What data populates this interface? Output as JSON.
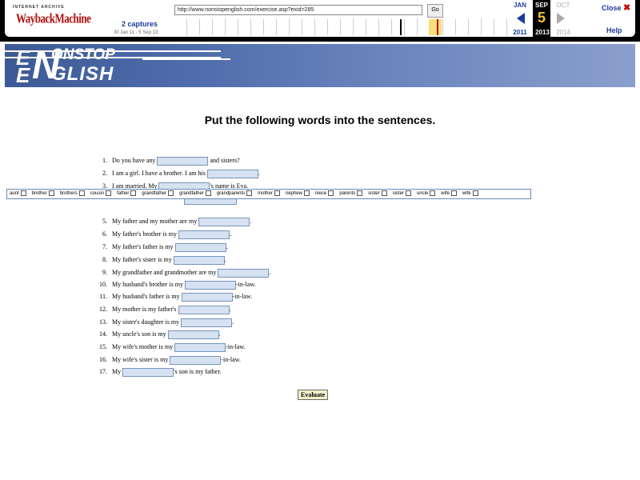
{
  "wayback": {
    "ia_label": "INTERNET ARCHIVE",
    "logo": "WaybackMachine",
    "url": "http://www.nonstopenglish.com/exercise.asp?exid=285",
    "go": "Go",
    "captures": "2 captures",
    "range": "30 Jan 11 - 5 Sep 13",
    "months": {
      "prev": "JAN",
      "current": "SEP",
      "next": "OCT"
    },
    "day": "5",
    "years": {
      "prev": "2011",
      "current": "2013",
      "next": "2014"
    },
    "close": "Close",
    "help": "Help"
  },
  "banner": {
    "top": "ONSTOP",
    "bottom": "GLISH",
    "e1": "E",
    "e2": "E",
    "big": "N"
  },
  "heading": "Put the following words into the sentences.",
  "word_bank": [
    "aunt",
    "brother",
    "brothers",
    "cousin",
    "father",
    "grandfather",
    "grandfather",
    "grandparents",
    "mother",
    "nephew",
    "niece",
    "parents",
    "sister",
    "sister",
    "uncle",
    "wife",
    "wife"
  ],
  "questions": [
    {
      "n": "1.",
      "pre": "Do you have any",
      "post": "and sisters?"
    },
    {
      "n": "2.",
      "pre": "I am a girl. I have a brother. I am his",
      "post": "."
    },
    {
      "n": "3.",
      "pre": "I am married. My",
      "post": "'s name is Eva."
    },
    {
      "n": "4.",
      "pre": "",
      "post": ""
    },
    {
      "n": "5.",
      "pre": "My father and my mother are my",
      "post": "."
    },
    {
      "n": "6.",
      "pre": "My father's brother is my",
      "post": "."
    },
    {
      "n": "7.",
      "pre": "My father's father is my",
      "post": "."
    },
    {
      "n": "8.",
      "pre": "My father's sister is my",
      "post": "."
    },
    {
      "n": "9.",
      "pre": "My grandfather and grandmother are my",
      "post": "."
    },
    {
      "n": "10.",
      "pre": "My husband's brother is my",
      "post": "-in-law."
    },
    {
      "n": "11.",
      "pre": "My husband's father is my",
      "post": "-in-law."
    },
    {
      "n": "12.",
      "pre": "My mother is my father's",
      "post": "."
    },
    {
      "n": "13.",
      "pre": "My sister's daughter is my",
      "post": "."
    },
    {
      "n": "14.",
      "pre": "My uncle's son is my",
      "post": "."
    },
    {
      "n": "15.",
      "pre": "My wife's mother is my",
      "post": "-in-law."
    },
    {
      "n": "16.",
      "pre": "My wife's sister is my",
      "post": "-in-law."
    },
    {
      "n": "17.",
      "pre": "My",
      "post": "'s son is my father."
    }
  ],
  "evaluate": "Evaluate"
}
